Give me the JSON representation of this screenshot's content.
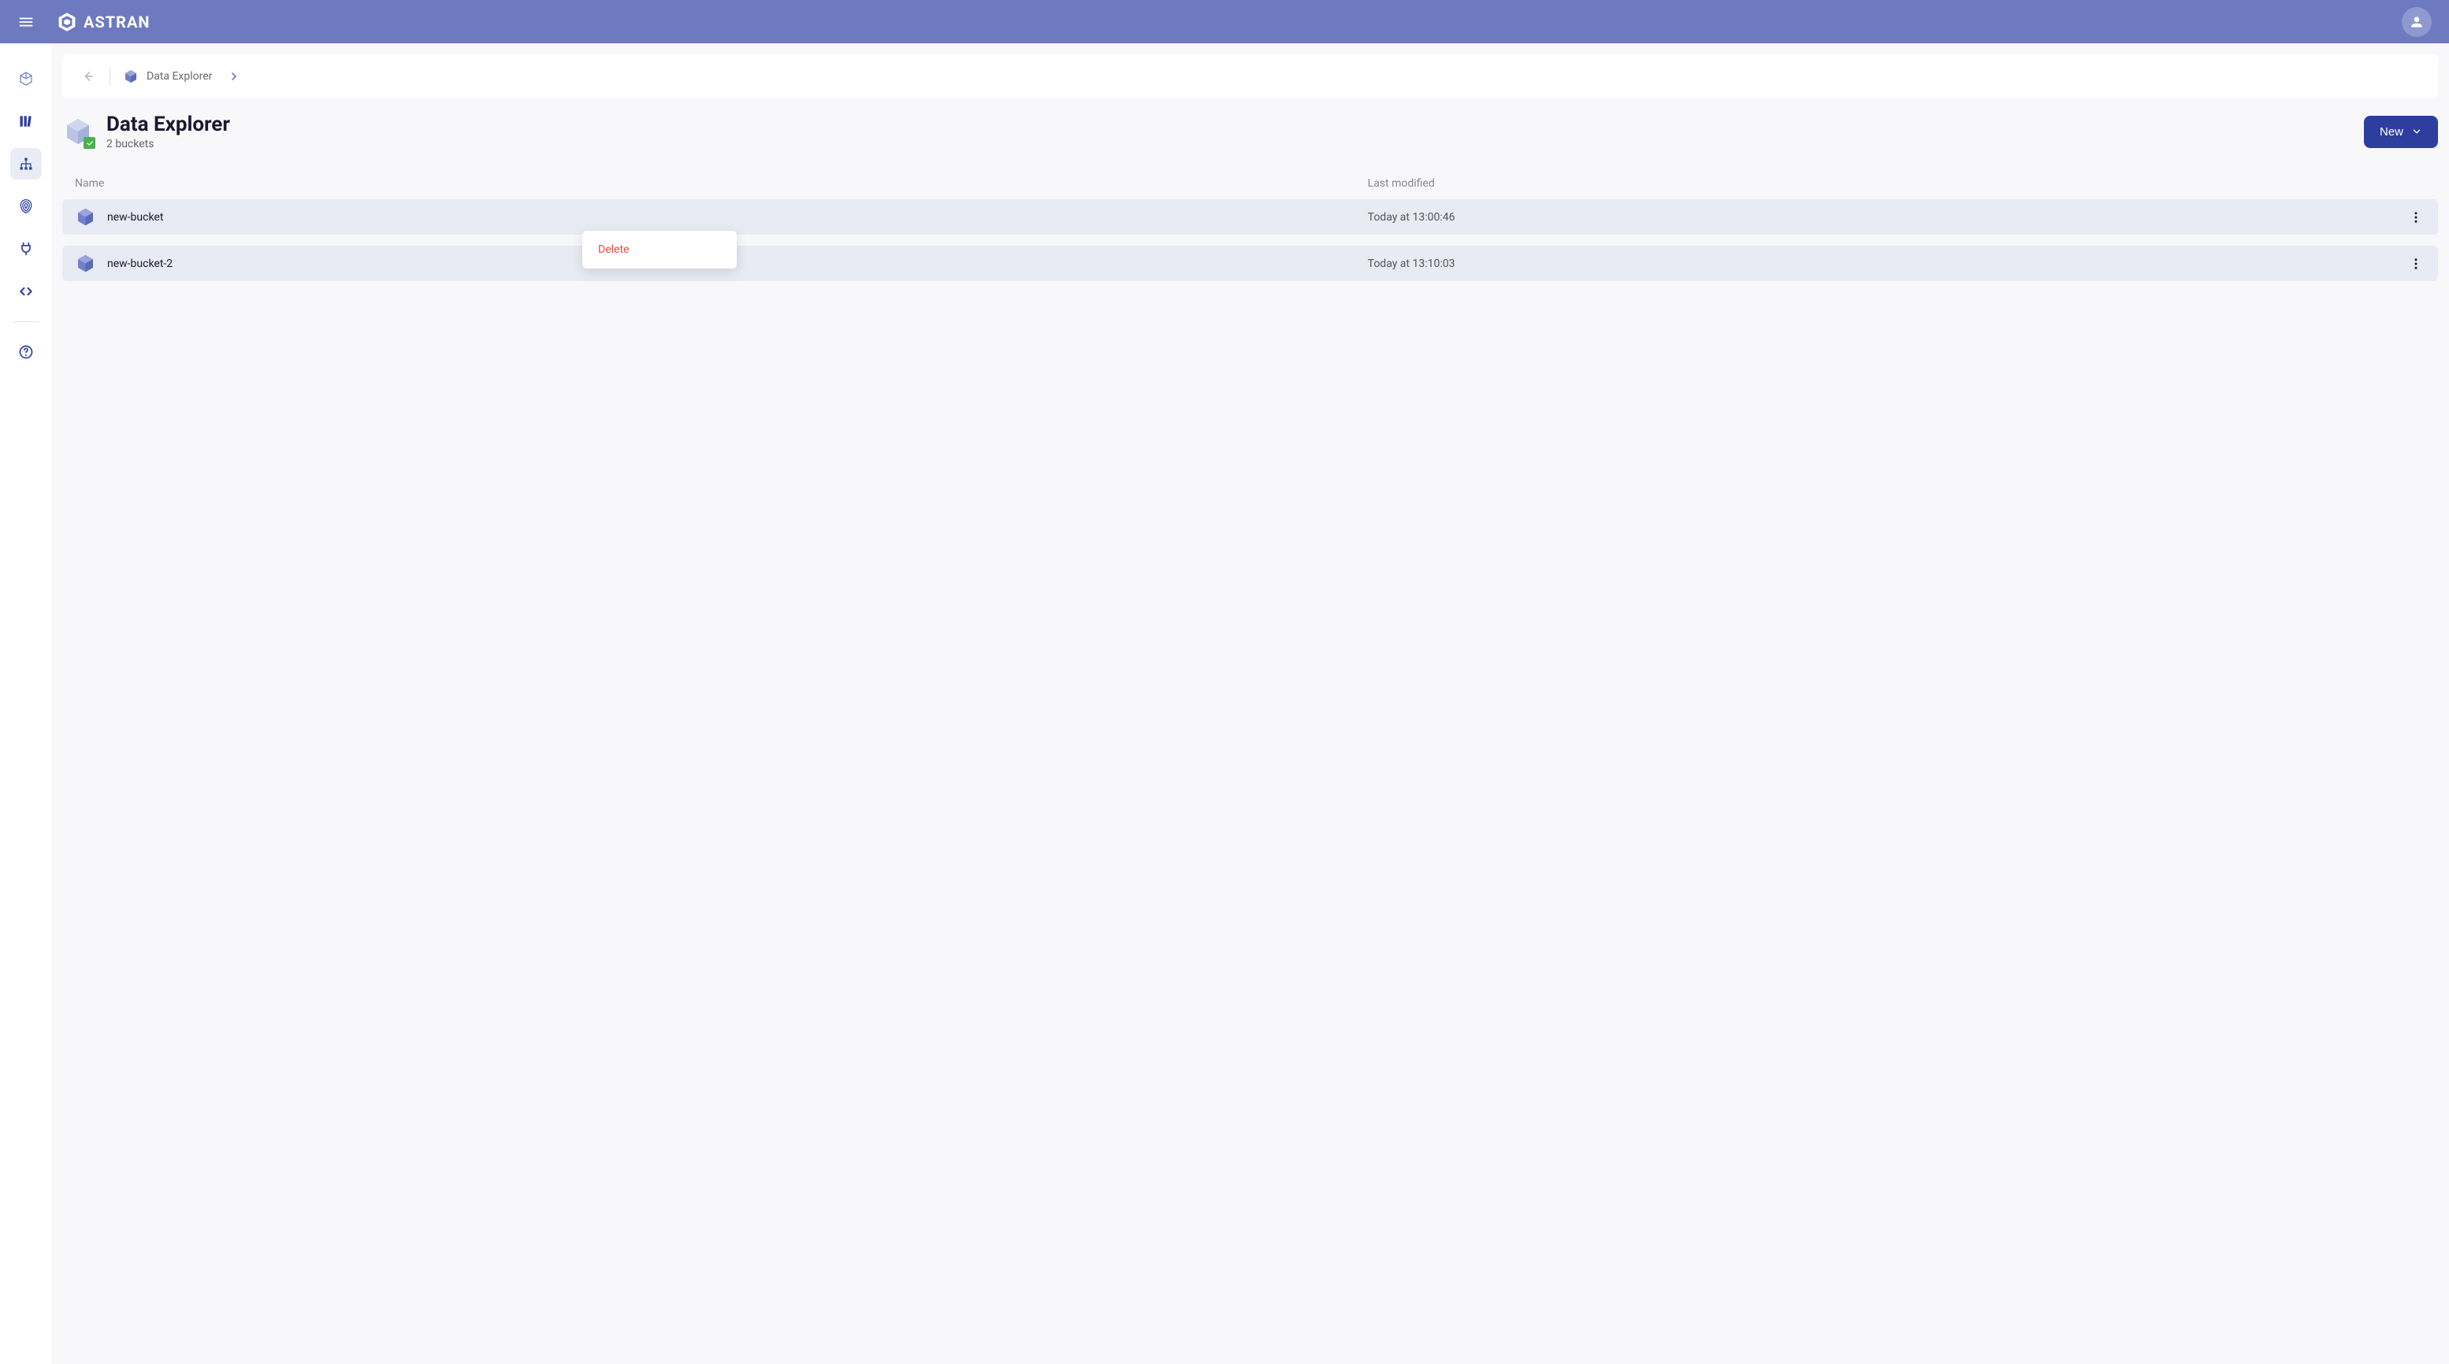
{
  "header": {
    "logo_text": "ASTRAN"
  },
  "breadcrumb": {
    "label": "Data Explorer"
  },
  "page": {
    "title": "Data Explorer",
    "subtitle": "2 buckets"
  },
  "actions": {
    "new_button": "New"
  },
  "table": {
    "columns": {
      "name": "Name",
      "modified": "Last modified"
    },
    "rows": [
      {
        "name": "new-bucket",
        "modified": "Today at 13:00:46"
      },
      {
        "name": "new-bucket-2",
        "modified": "Today at 13:10:03"
      }
    ]
  },
  "context_menu": {
    "delete": "Delete"
  }
}
